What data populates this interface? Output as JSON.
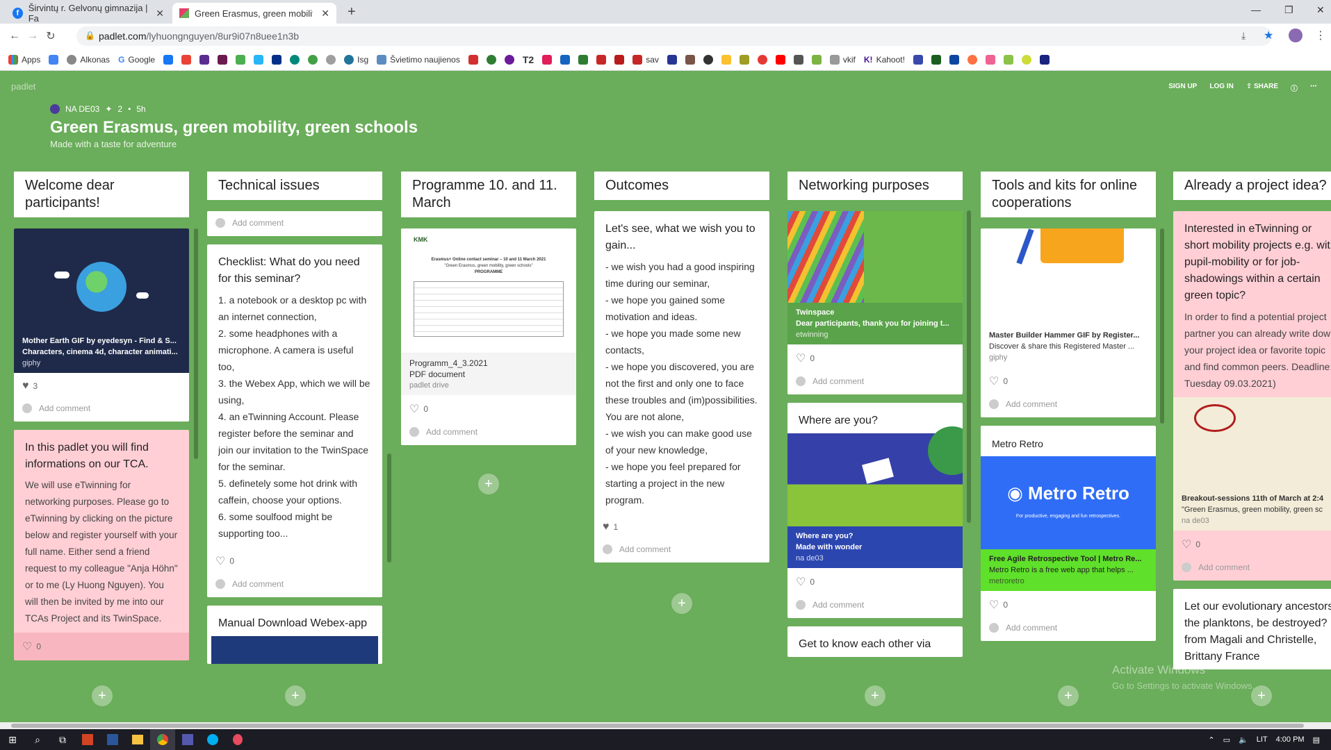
{
  "browser": {
    "tabs": [
      {
        "label": "Širvintų r. Gelvonų gimnazija | Fa"
      },
      {
        "label": "Green Erasmus, green mobility, g"
      }
    ],
    "url_host": "padlet.com",
    "url_path": "/lyhuongnguyen/8ur9i07n8uee1n3b",
    "bookmarks": [
      "Apps",
      "Alkonas",
      "Google",
      "Isg",
      "Švietimo naujienos",
      "T2",
      "sav",
      "vkif",
      "Kahoot!"
    ]
  },
  "padlet": {
    "logo": "padlet",
    "links": {
      "signup": "SIGN UP",
      "login": "LOG IN",
      "share": "SHARE"
    },
    "author": "NA DE03",
    "contributors": "2",
    "age": "5h",
    "title": "Green Erasmus, green mobility, green schools",
    "subtitle": "Made with a taste for adventure"
  },
  "columns": [
    {
      "heading": "Welcome dear participants!",
      "cards": [
        {
          "attach_title": "Mother Earth GIF by eyedesyn - Find & S...",
          "attach_sub": "Characters, cinema 4d, character animati...",
          "attach_src": "giphy",
          "likes": "3",
          "comment": "Add comment"
        },
        {
          "title": "In this padlet you will find informations on our TCA.",
          "body": "We will use eTwinning for networking purposes. Please go to eTwinning by clicking on the picture below and register yourself with your full name. Either send a friend request to my colleague \"Anja Höhn\" or to me (Ly Huong Nguyen). You will then be invited by me into our TCAs Project and its TwinSpace.",
          "likes": "0"
        }
      ]
    },
    {
      "heading": "Technical issues",
      "cards": [
        {
          "comment": "Add comment"
        },
        {
          "title": "Checklist: What do you need for this seminar?",
          "body": "1. a notebook or a desktop pc with an internet connection,\n2. some headphones with a microphone. A camera is useful too,\n3. the Webex App, which we will be using,\n4. an eTwinning Account. Please register before the seminar and join our invitation to the TwinSpace for the seminar.\n5. definetely some hot drink with caffein, choose your options.\n6. some soulfood might be supporting too...",
          "likes": "0",
          "comment": "Add comment"
        },
        {
          "title": "Manual Download Webex-app"
        }
      ]
    },
    {
      "heading": "Programme 10. and 11. March",
      "cards": [
        {
          "doc_heading": "Erasmus+ Online contact seminar – 10 and 11 March 2021",
          "doc_sub": "\"Green Erasmus, green mobility, green schools\"",
          "doc_label": "PROGRAMME",
          "attach_title": "Programm_4_3.2021",
          "attach_sub": "PDF document",
          "attach_src": "padlet drive",
          "likes": "0",
          "comment": "Add comment"
        }
      ]
    },
    {
      "heading": "Outcomes",
      "cards": [
        {
          "title": "Let's see, what we wish you to gain...",
          "body": "- we wish you had a good inspiring time during our seminar,\n- we hope you gained some motivation and ideas.\n- we hope you made some new contacts,\n- we hope you discovered, you are not the first and only one to face these troubles and (im)possibilities. You are not alone,\n- we wish you can make good use of your new knowledge,\n- we hope you feel prepared for starting a project in the new program.",
          "likes": "1",
          "comment": "Add comment"
        }
      ]
    },
    {
      "heading": "Networking purposes",
      "cards": [
        {
          "attach_title": "Twinspace",
          "attach_sub": "Dear participants, thank you for joining t...",
          "attach_src": "etwinning",
          "likes": "0",
          "comment": "Add comment"
        },
        {
          "title": "Where are you?",
          "attach_title": "Where are you?",
          "attach_sub": "Made with wonder",
          "attach_src": "na de03",
          "likes": "0",
          "comment": "Add comment"
        },
        {
          "title": "Get to know each other via"
        }
      ]
    },
    {
      "heading": "Tools and kits for online cooperations",
      "cards": [
        {
          "attach_title": "Master Builder Hammer GIF by Register...",
          "attach_sub": "Discover & share this Registered Master ...",
          "attach_src": "giphy",
          "likes": "0",
          "comment": "Add comment"
        },
        {
          "title": "Metro Retro",
          "banner": "Metro Retro",
          "banner_sub": "For productive, engaging and fun retrospectives.",
          "attach_title": "Free Agile Retrospective Tool | Metro Re...",
          "attach_sub": "Metro Retro is a free web app that helps ...",
          "attach_src": "metroretro",
          "likes": "0",
          "comment": "Add comment"
        }
      ]
    },
    {
      "heading": "Already a project idea?",
      "cards": [
        {
          "title": "Interested in eTwinning or short mobility projects e.g. with pupil-mobility or for job-shadowings within a certain green topic?",
          "body": "In order to find a potential project partner you can already write down your project idea or favorite topic and find common peers. Deadline: Tuesday 09.03.2021)",
          "attach_title": "Breakout-sessions 11th of March at 2:4",
          "attach_sub": "\"Green Erasmus, green mobility, green sc",
          "attach_src": "na de03",
          "likes": "0",
          "comment": "Add comment"
        },
        {
          "title": "Let our evolutionary ancestors, the planktons, be destroyed? from Magali and Christelle, Brittany France"
        }
      ]
    }
  ],
  "watermark": {
    "line1": "Activate Windows",
    "line2": "Go to Settings to activate Windows."
  },
  "taskbar": {
    "lang": "LIT",
    "time": "4:00 PM"
  }
}
